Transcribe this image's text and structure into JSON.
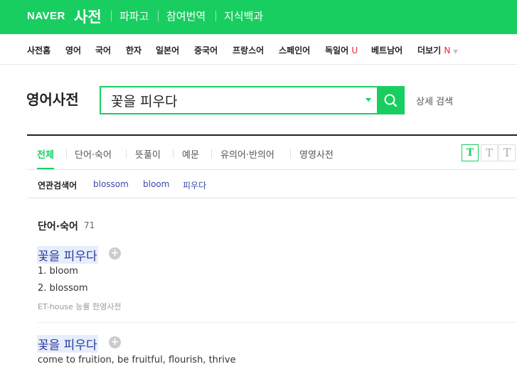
{
  "header": {
    "logo": "NAVER",
    "service": "사전",
    "nav": [
      "파파고",
      "참여번역",
      "지식백과"
    ]
  },
  "languages": {
    "items": [
      "사전홈",
      "영어",
      "국어",
      "한자",
      "일본어",
      "중국어",
      "프랑스어",
      "스페인어",
      "독일어",
      "베트남어",
      "더보기"
    ],
    "german_badge": "U",
    "more_badge": "N"
  },
  "search": {
    "dictionary_title": "영어사전",
    "query": "꽃을 피우다",
    "detail_link": "상세 검색"
  },
  "tabs": [
    "전체",
    "단어·숙어",
    "뜻풀이",
    "예문",
    "유의어·반의어",
    "영영사전"
  ],
  "font_size_buttons": [
    "T",
    "T",
    "T"
  ],
  "related": {
    "label": "연관검색어",
    "terms": [
      "blossom",
      "bloom",
      "피우다"
    ]
  },
  "section": {
    "title": "단어·숙어",
    "count": "71"
  },
  "entries": [
    {
      "word": "꽃을 피우다",
      "meanings": [
        "1. bloom",
        "2. blossom"
      ],
      "source": "ET-house 능률 한영사전"
    },
    {
      "word": "꽃을 피우다",
      "meanings": [
        "come to fruition, be fruitful, flourish, thrive"
      ]
    }
  ],
  "colors": {
    "brand_green": "#19ce60",
    "link_blue": "#3a49a6"
  }
}
